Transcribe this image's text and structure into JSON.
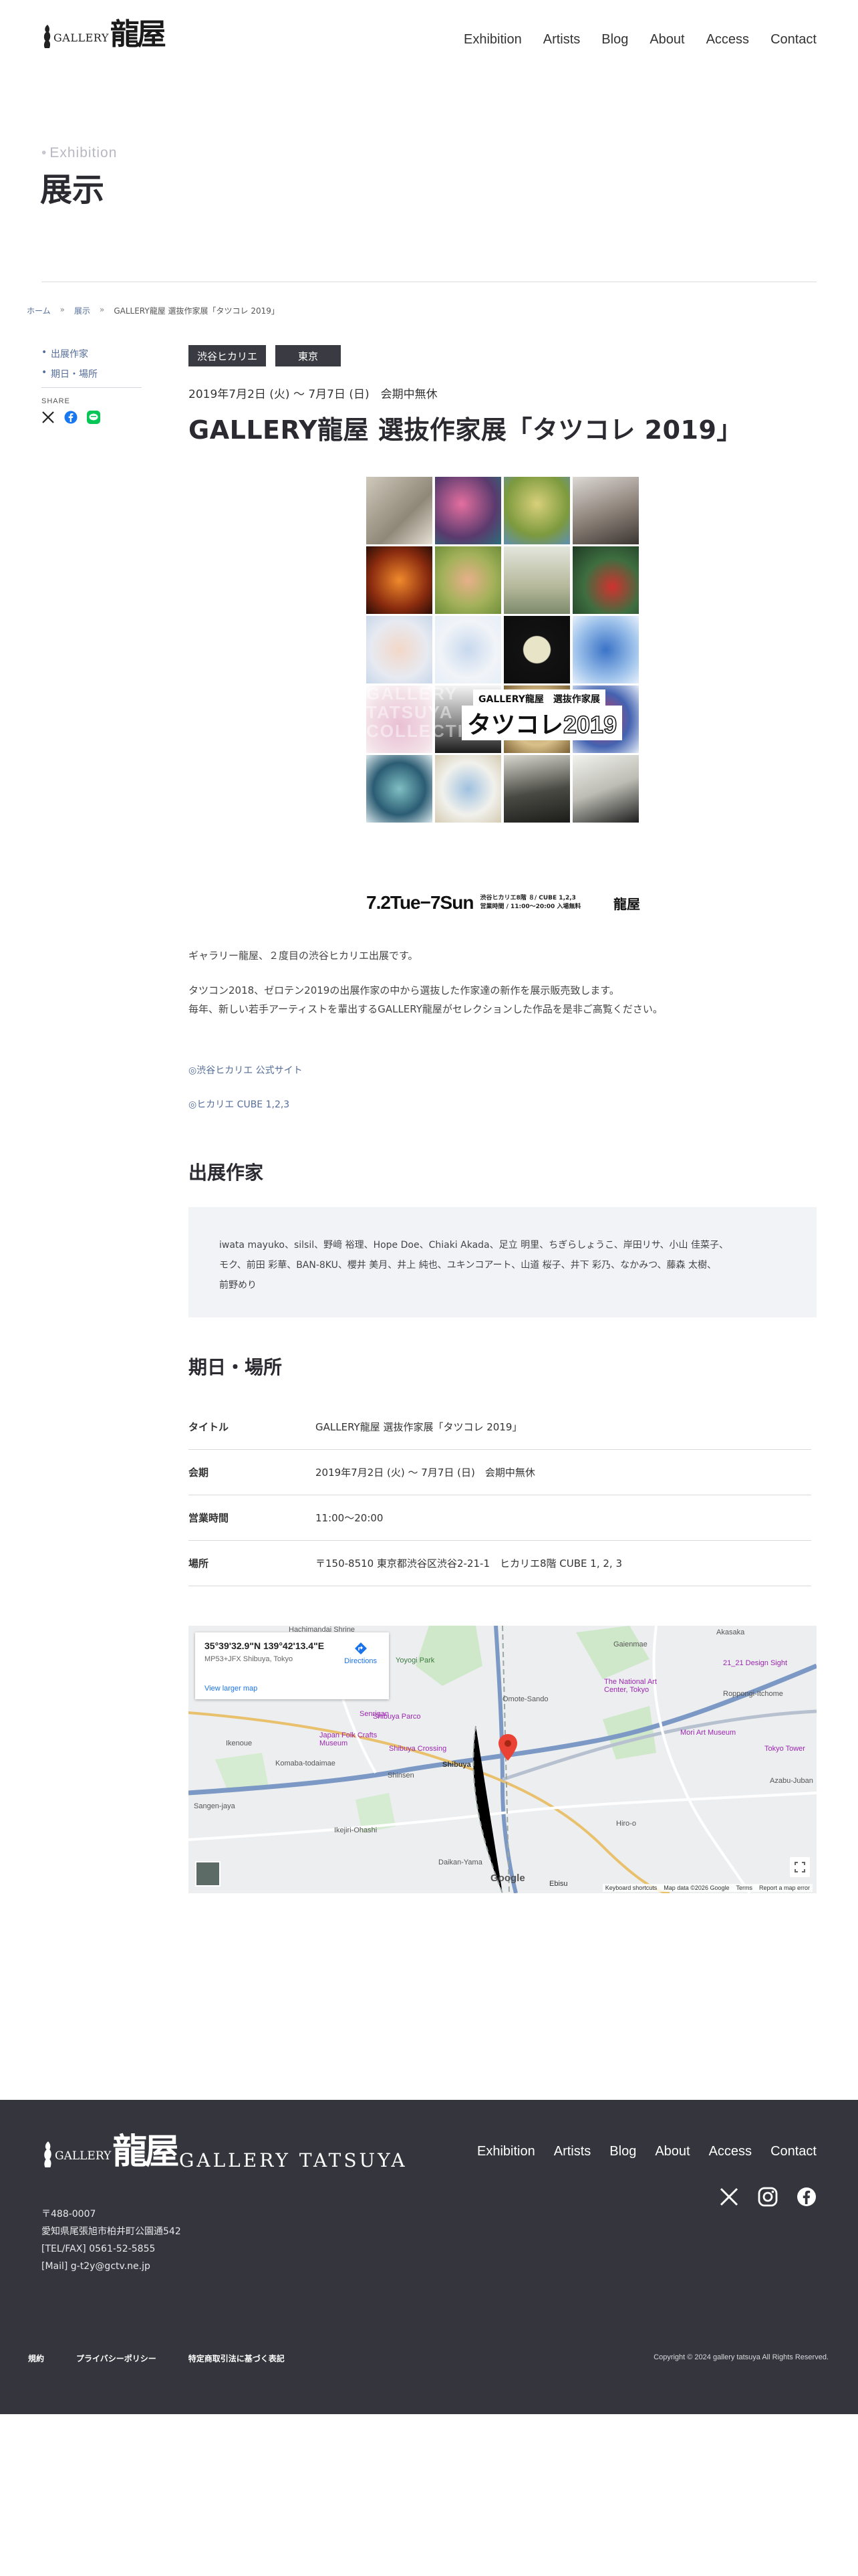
{
  "header": {
    "logo_text": "GALLERY",
    "logo_kanji": "龍屋",
    "nav": [
      "Exhibition",
      "Artists",
      "Blog",
      "About",
      "Access",
      "Contact"
    ]
  },
  "page_title": {
    "en": "Exhibition",
    "ja": "展示"
  },
  "breadcrumb": {
    "home": "ホーム",
    "section": "展示",
    "current": "GALLERY龍屋 選抜作家展「タツコレ 2019」",
    "separator": "»"
  },
  "sidebar": {
    "links": [
      "出展作家",
      "期日・場所"
    ],
    "share_label": "SHARE",
    "share_icons": [
      "x-icon",
      "facebook-icon",
      "line-icon"
    ]
  },
  "exhibition": {
    "tags": [
      "渋谷ヒカリエ",
      "東京"
    ],
    "date": "2019年7月2日 (火) 〜 7月7日 (日)　会期中無休",
    "title": "GALLERY龍屋 選抜作家展「タツコレ 2019」",
    "poster": {
      "overlay_en_1": "GALLERY",
      "overlay_en_2": "TATSUYA",
      "overlay_en_3": "COLLECTION",
      "banner_small": "GALLERY龍屋　選抜作家展",
      "banner_big": "タツコレ",
      "banner_year": "2019",
      "dates": "7.2Tue−7Sun",
      "venue_line1": "渋谷ヒカリエ8階 ８/ CUBE 1,2,3",
      "venue_line2": "営業時間 / 11:00〜20:00 入場無料",
      "mini_logo": "龍屋"
    },
    "description": [
      "ギャラリー龍屋、２度目の渋谷ヒカリエ出展です。",
      "タツコン2018、ゼロテン2019の出展作家の中から選抜した作家達の新作を展示販売致します。",
      "毎年、新しい若手アーティストを輩出するGALLERY龍屋がセレクションした作品を是非ご高覧ください。"
    ],
    "links": [
      "◎渋谷ヒカリエ 公式サイト",
      "◎ヒカリエ CUBE 1,2,3"
    ]
  },
  "artists_section": {
    "heading": "出展作家",
    "line1": "iwata mayuko、silsil、野﨑 裕理、Hope Doe、Chiaki Akada、足立 明里、ちぎらしょうこ、岸田リサ、小山 佳菜子、",
    "line2": "モク、前田 彩華、BAN-8KU、櫻井 美月、井上 純也、ユキンコアート、山道 桜子、井下 彩乃、なかみつ、藤森 太樹、",
    "line3": "前野めり"
  },
  "venue_section": {
    "heading": "期日・場所",
    "rows": [
      {
        "key": "タイトル",
        "value": "GALLERY龍屋 選抜作家展「タツコレ 2019」"
      },
      {
        "key": "会期",
        "value": "2019年7月2日 (火) 〜 7月7日 (日)　会期中無休"
      },
      {
        "key": "営業時間",
        "value": "11:00〜20:00"
      },
      {
        "key": "場所",
        "value": "〒150-8510 東京都渋谷区渋谷2-21-1　ヒカリエ8階 CUBE 1, 2, 3"
      }
    ]
  },
  "map": {
    "coord": "35°39'32.9\"N 139°42'13.4\"E",
    "address": "MP53+JFX Shibuya, Tokyo",
    "directions": "Directions",
    "larger_map": "View larger map",
    "google": "Google",
    "footer_items": [
      "Keyboard shortcuts",
      "Map data ©2026 Google",
      "Terms",
      "Report a map error"
    ],
    "labels": {
      "yoyogi": "Yoyogi Park",
      "hachiman": "Hachimandai Shrine",
      "gaienmae": "Gaienmae",
      "akasaka": "Akasaka",
      "national_art": "The National Art Center, Tokyo",
      "design_sight": "21_21 Design Sight",
      "roppongi": "Roppongi-Itchome",
      "mori": "Mori Art Museum",
      "tokyo_tower": "Tokyo Tower",
      "omotesando": "Omote-Sando",
      "shibuya_parco": "Shibuya Parco",
      "japan_folk": "Japan Folk Crafts Museum",
      "shibuya_crossing": "Shibuya Crossing",
      "shibuya": "Shibuya",
      "ebisu": "Ebisu",
      "daikanyama": "Daikan-Yama",
      "ikenoue": "Ikenoue",
      "komaba": "Komaba-todaimae",
      "sangenjaya": "Sangen-jaya",
      "hiroo": "Hiro-o",
      "azabu": "Azabu-Juban",
      "senrigan": "Senrigan",
      "ikejiri": "Ikejiri-Ohashi",
      "shinsen": "Shinsen"
    }
  },
  "footer": {
    "logo_text": "GALLERY",
    "logo_kanji": "龍屋",
    "brand": "GALLERY TATSUYA",
    "nav": [
      "Exhibition",
      "Artists",
      "Blog",
      "About",
      "Access",
      "Contact"
    ],
    "social_icons": [
      "x-icon",
      "instagram-icon",
      "facebook-icon"
    ],
    "address": [
      "〒488-0007",
      "愛知県尾張旭市柏井町公園通542",
      "[TEL/FAX] 0561-52-5855",
      "[Mail] g-t2y@gctv.ne.jp"
    ],
    "links": [
      "規約",
      "プライバシーポリシー",
      "特定商取引法に基づく表記"
    ],
    "copyright": "Copyright © 2024 gallery tatsuya All Rights Reserved."
  },
  "colors": {
    "accent_link": "#556d99",
    "footer_bg": "#35353d",
    "tag_bg": "#3a3a42",
    "artist_box_bg": "#f1f3f7"
  }
}
